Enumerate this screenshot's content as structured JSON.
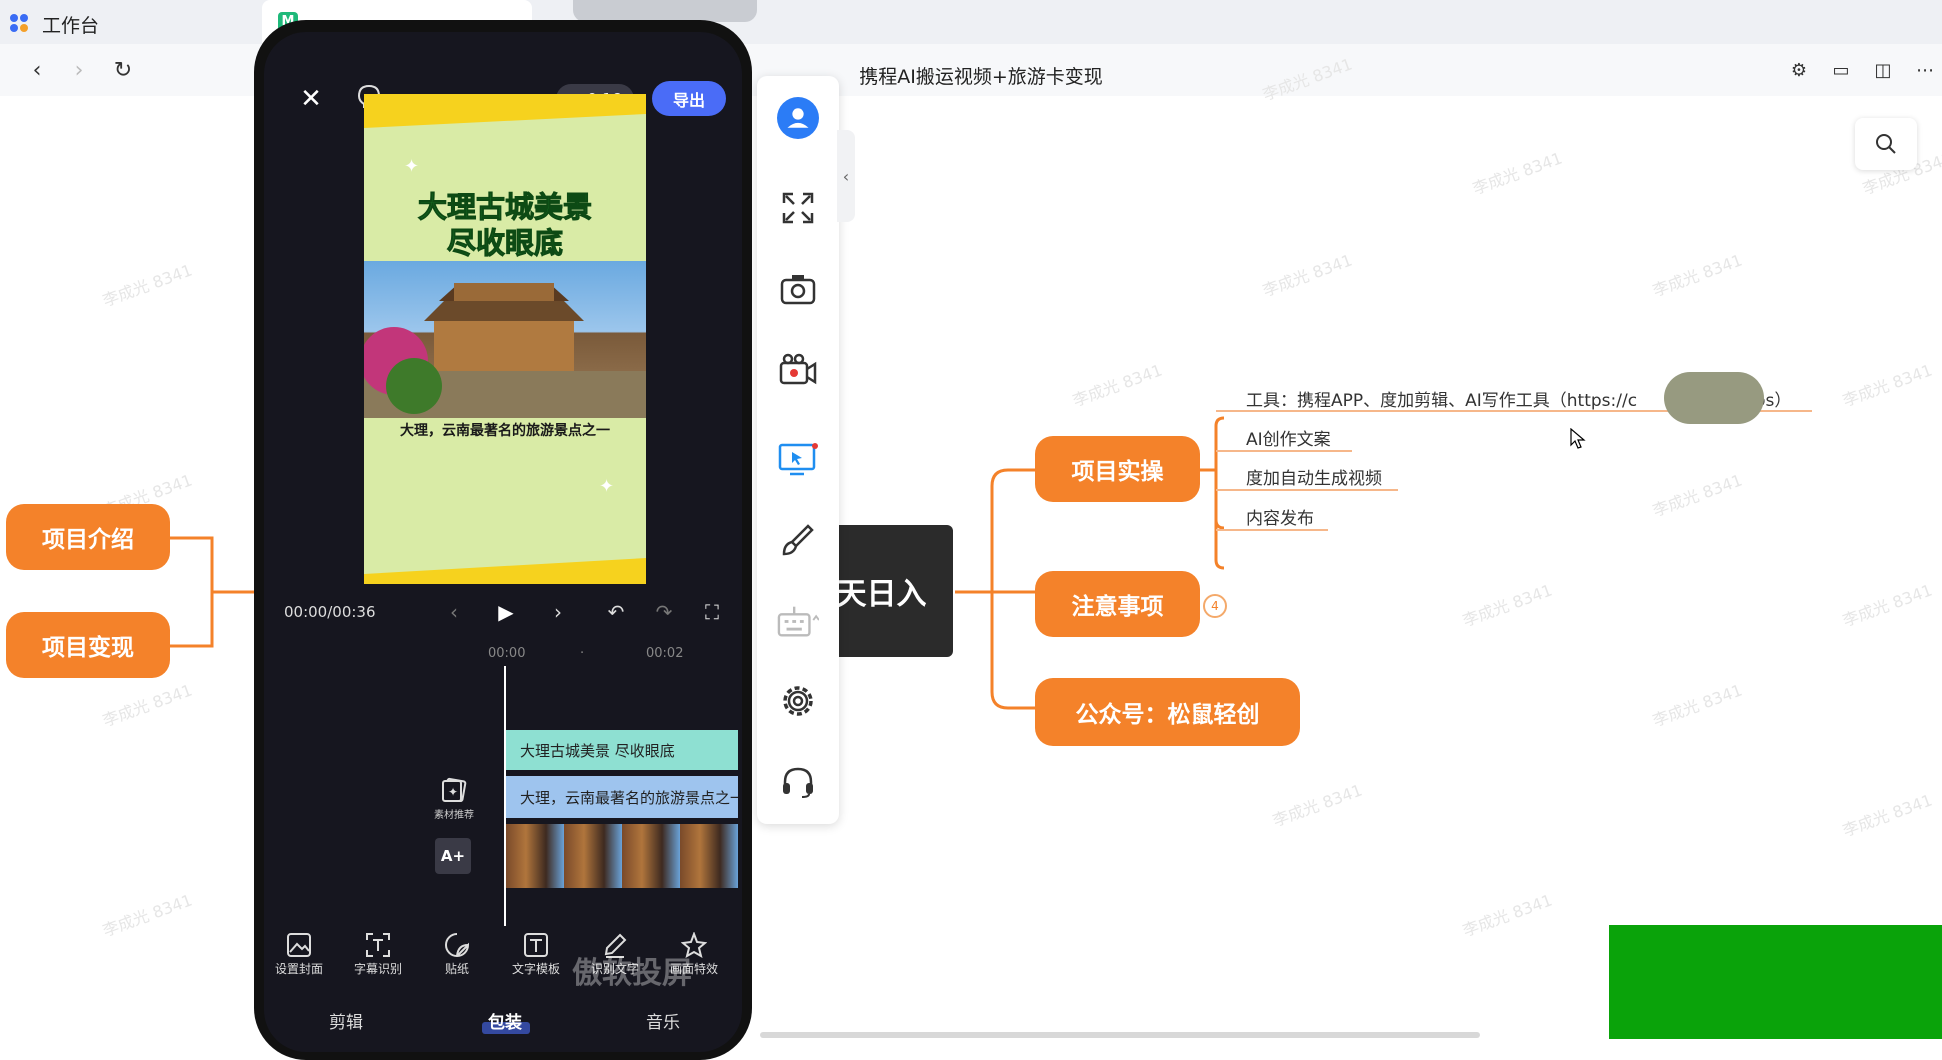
{
  "browser": {
    "workspace_title": "工作台",
    "tab2_title": "",
    "doc_title": "携程AI搬运视频+旅游卡变现"
  },
  "watermark": "李成光 8341",
  "mindmap": {
    "central_text": "天日入",
    "left_nodes": [
      "项目介绍",
      "项目变现"
    ],
    "right_nodes": {
      "shicao": {
        "label": "项目实操",
        "children": [
          "工具：携程APP、度加剪辑、AI写作工具（https://c",
          "os）",
          "AI创作文案",
          "度加自动生成视频",
          "内容发布"
        ]
      },
      "zhuyi": {
        "label": "注意事项",
        "badge": "4"
      },
      "gongzhong": {
        "label": "公众号：松鼠轻创"
      }
    }
  },
  "phone": {
    "ratio": "9:16",
    "export": "导出",
    "video_headline_1": "大理古城美景",
    "video_headline_2": "尽收眼底",
    "video_caption": "大理，云南最著名的旅游景点之一",
    "time": "00:00/00:36",
    "ruler_0": "00:00",
    "ruler_dot": "·",
    "ruler_2": "00:02",
    "clip1": "大理古城美景 尽收眼底",
    "clip2": "大理，云南最著名的旅游景点之一",
    "side_tool_1": "素材推荐",
    "side_tool_2": "A+",
    "tools": [
      "设置封面",
      "字幕识别",
      "贴纸",
      "文字模板",
      "识别文字",
      "画面特效"
    ],
    "tabs": [
      "剪辑",
      "包装",
      "音乐"
    ],
    "overlay": "傲软投屏"
  },
  "colors": {
    "accent_orange": "#f4822a",
    "accent_blue": "#4a6cf7",
    "green_block": "#0aa30a"
  }
}
